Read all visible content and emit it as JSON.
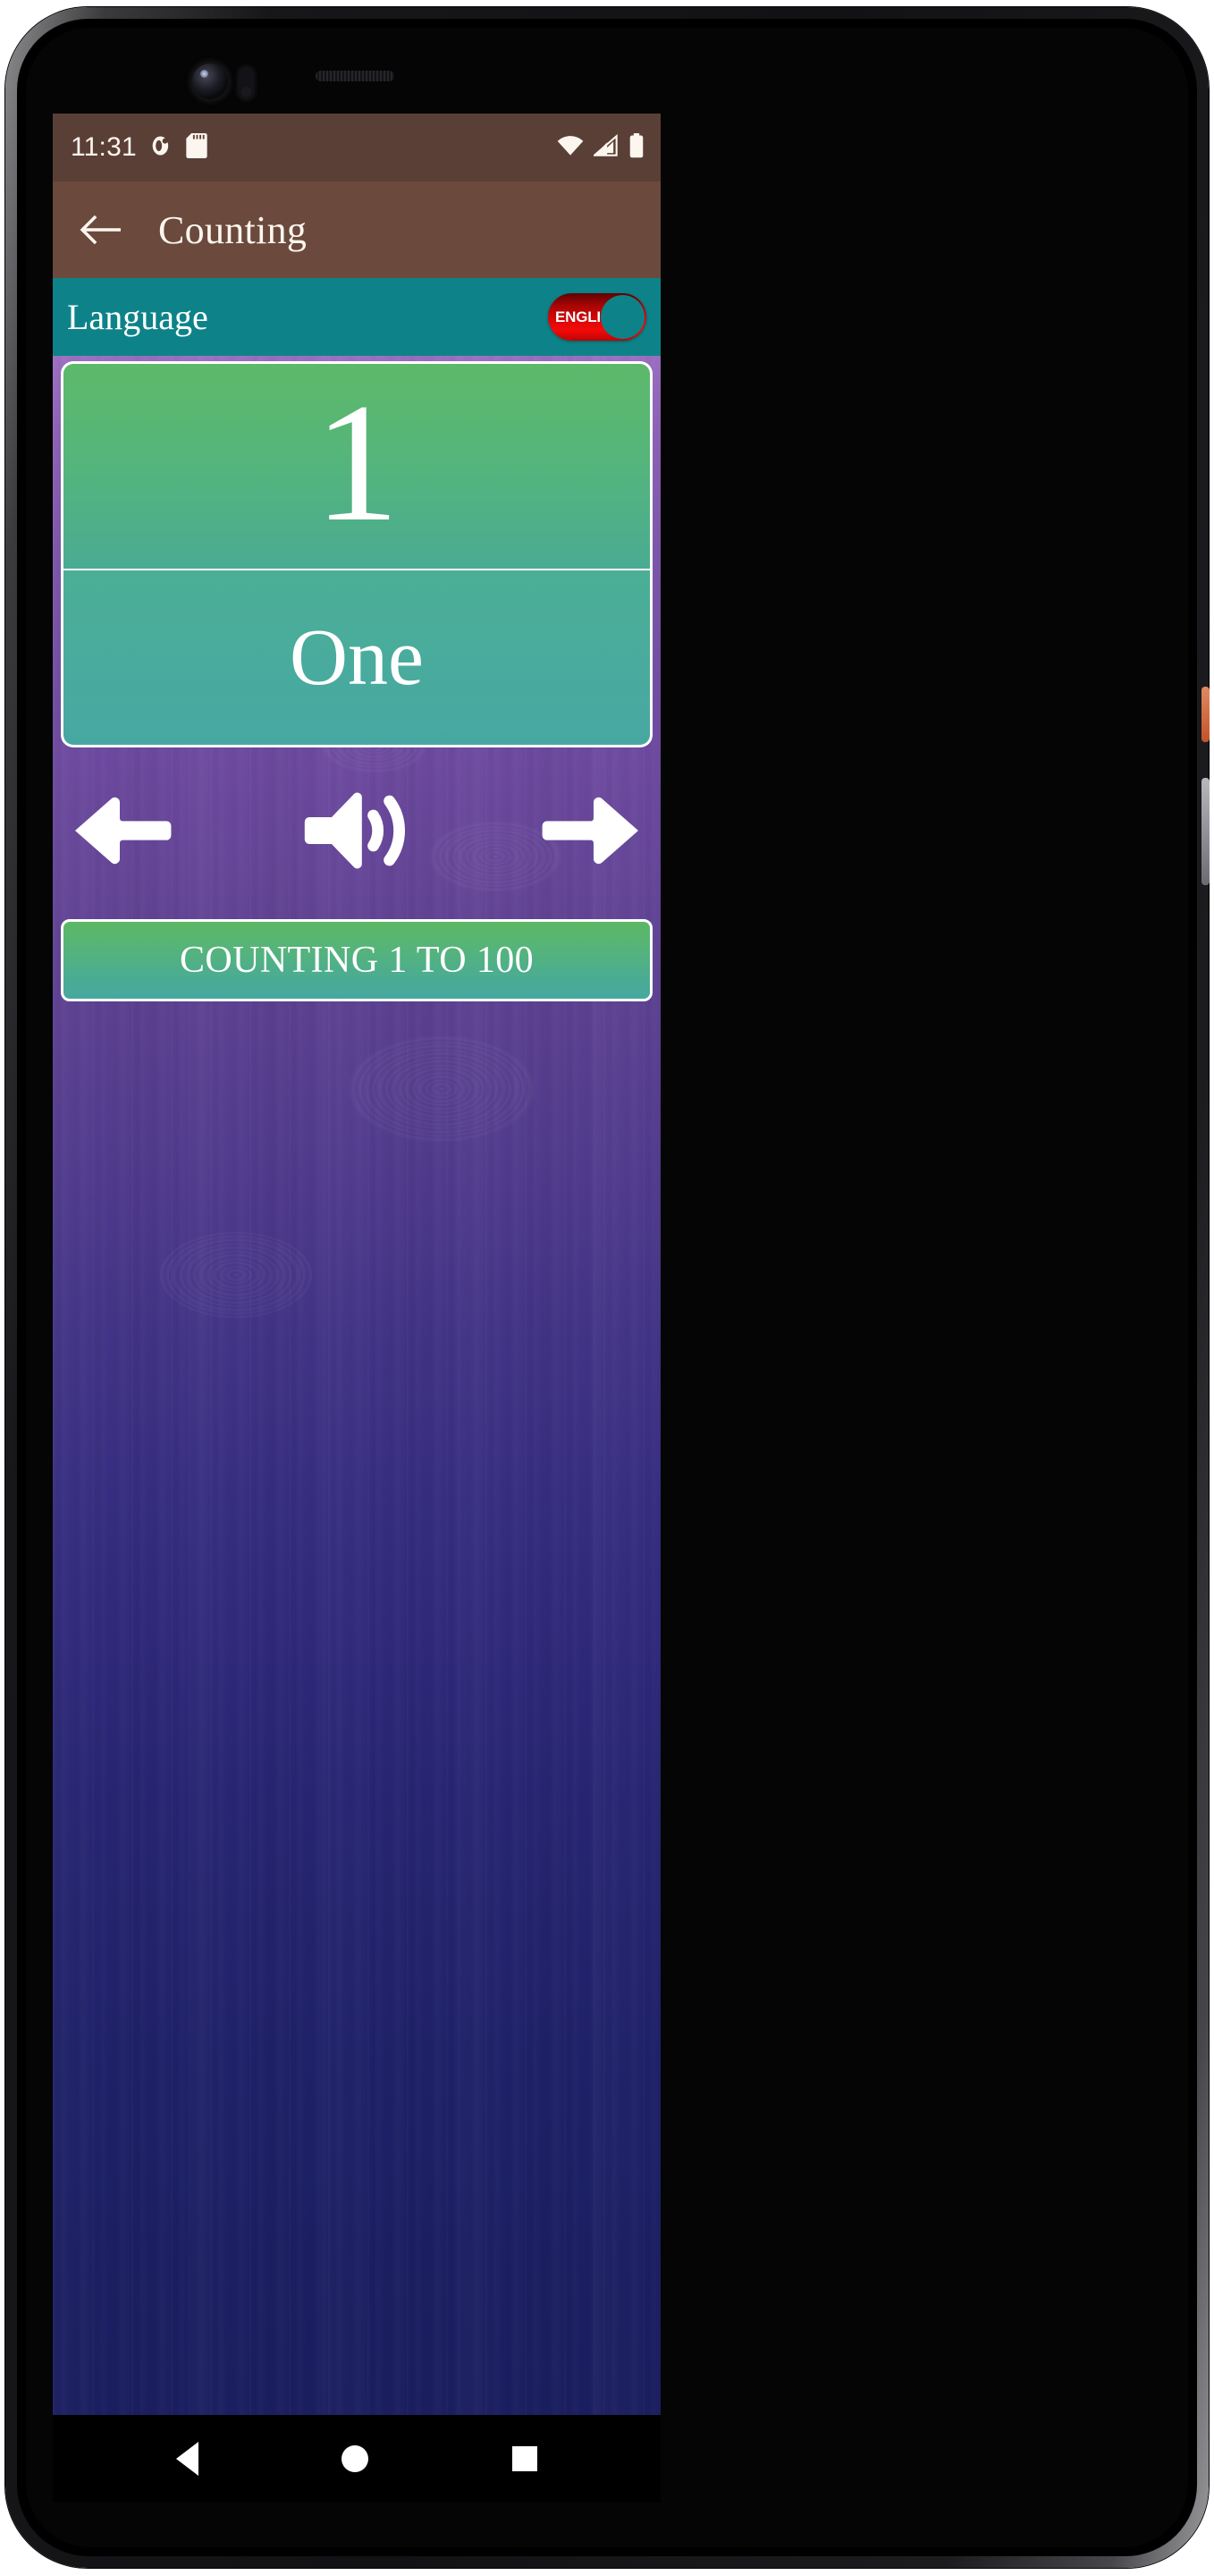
{
  "statusbar": {
    "time": "11:31",
    "icons_left": [
      "app-notification-icon",
      "sd-card-icon"
    ],
    "icons_right": [
      "wifi-icon",
      "cellular-signal-icon",
      "battery-icon"
    ],
    "background_color": "#5A3F37"
  },
  "appbar": {
    "back_icon": "back-arrow-icon",
    "title": "Counting",
    "background_color": "#6B4A3D"
  },
  "language_bar": {
    "label": "Language",
    "toggle_value": "ENGLISH",
    "toggle_state": "on",
    "background_color": "#0D8389",
    "toggle_color": "#E00707"
  },
  "cards": {
    "number": "1",
    "word": "One",
    "number_card_color": "#5DB96A",
    "word_card_color": "#4BAE95"
  },
  "controls": {
    "previous_icon": "left-arrow-icon",
    "speaker_icon": "speaker-volume-icon",
    "next_icon": "right-arrow-icon"
  },
  "counting_button": {
    "label": "COUNTING 1 TO 100",
    "color_start": "#5CB865",
    "color_end": "#47A8A0"
  },
  "navbar": {
    "back": "android-back-icon",
    "home": "android-home-icon",
    "recents": "android-recents-icon"
  }
}
